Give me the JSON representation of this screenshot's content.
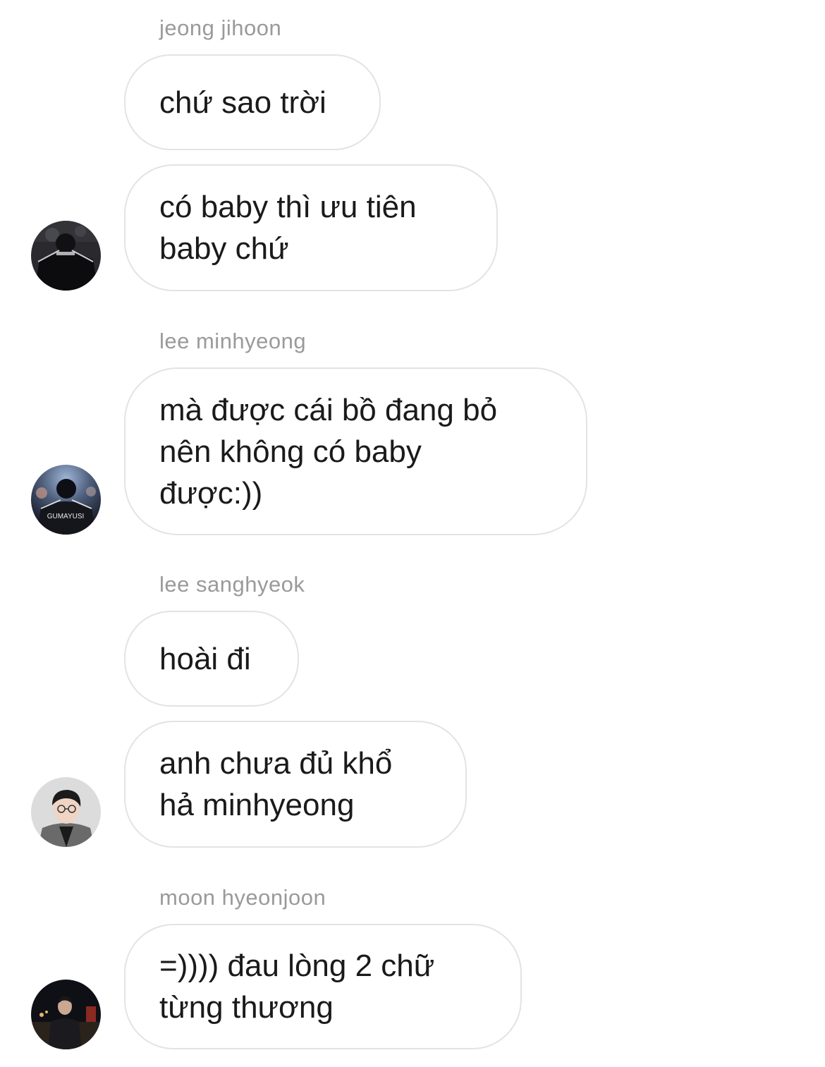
{
  "messages": [
    {
      "sender": "jeong jihoon",
      "bubbles": [
        "chứ sao trời",
        "có baby thì ưu tiên\nbaby chứ"
      ],
      "avatar": "profile-photo-1"
    },
    {
      "sender": "lee minhyeong",
      "bubbles": [
        "mà được cái bồ đang bỏ\nnên không có baby\nđược:))"
      ],
      "avatar": "profile-photo-2",
      "avatar_text": "GUMAYUSI"
    },
    {
      "sender": "lee sanghyeok",
      "bubbles": [
        "hoài đi",
        "anh chưa đủ khổ\nhả minhyeong"
      ],
      "avatar": "profile-photo-3"
    },
    {
      "sender": "moon hyeonjoon",
      "bubbles": [
        "=)))) đau lòng 2 chữ\ntừng thương"
      ],
      "avatar": "profile-photo-4"
    }
  ]
}
